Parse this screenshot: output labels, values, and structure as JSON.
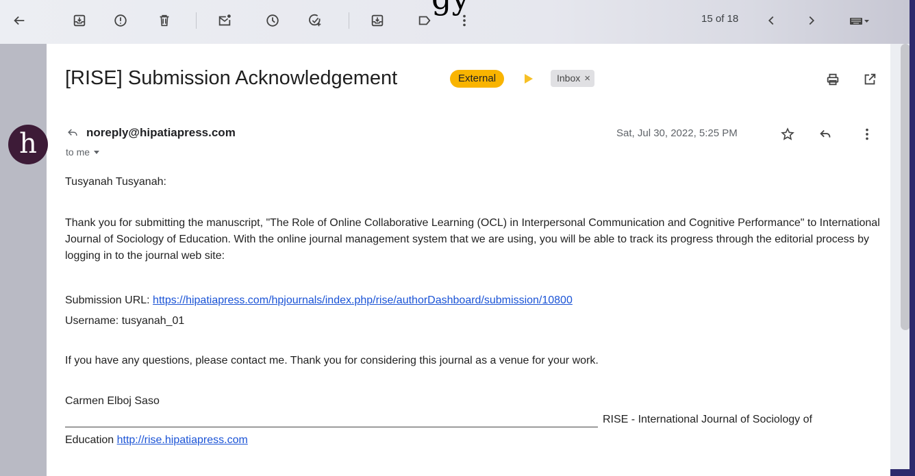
{
  "decor_text": "gy",
  "toolbar": {
    "pager": "15 of 18",
    "icons": [
      "arrow-left-icon",
      "archive-icon",
      "report-spam-icon",
      "trash-icon",
      "mark-unread-icon",
      "snooze-icon",
      "add-task-icon",
      "move-to-icon",
      "label-icon",
      "more-vert-icon",
      "chevron-left-icon",
      "chevron-right-icon",
      "keyboard-icon"
    ]
  },
  "email": {
    "subject": "[RISE] Submission Acknowledgement",
    "badge_external": "External",
    "label_inbox": "Inbox",
    "label_remove": "×",
    "avatar_letter": "h",
    "sender": "noreply@hipatiapress.com",
    "to": "to me",
    "date": "Sat, Jul 30, 2022, 5:25 PM",
    "body": {
      "greeting": "Tusyanah Tusyanah:",
      "para1": "Thank you for submitting the manuscript, \"The Role of Online Collaborative Learning (OCL) in Interpersonal Communication and Cognitive Performance\" to International Journal of Sociology of Education. With the online journal management system that we are using, you will be able to track its progress through the editorial process by logging in to the journal web site:",
      "url_label": "Submission URL: ",
      "url": "https://hipatiapress.com/hpjournals/index.php/rise/authorDashboard/submission/10800",
      "username": "Username: tusyanah_01",
      "para2": "If you have any questions, please contact me. Thank you for considering this journal as a venue for your work.",
      "signature": "Carmen Elboj Saso",
      "journal_line": "RISE - International Journal of Sociology of",
      "journal_line2": "Education ",
      "journal_url": "http://rise.hipatiapress.com"
    }
  },
  "colors": {
    "accent_link": "#1a53d6",
    "badge_external": "#f9b400",
    "avatar_bg": "#3d1b37"
  }
}
